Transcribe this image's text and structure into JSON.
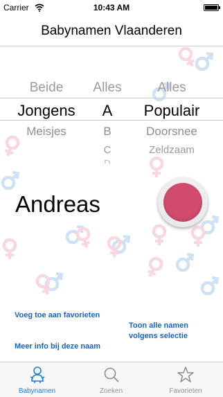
{
  "status_bar": {
    "carrier": "Carrier",
    "time": "10:43 AM"
  },
  "navbar": {
    "title": "Babynamen Vlaanderen"
  },
  "picker": {
    "gender": {
      "above": "Beide",
      "selected": "Jongens",
      "below": [
        "Meisjes"
      ]
    },
    "letter": {
      "above": "Alles",
      "selected": "A",
      "below": [
        "B",
        "C",
        "D"
      ]
    },
    "popularity": {
      "above": "Alles",
      "selected": "Populair",
      "below": [
        "Doorsnee",
        "Zeldzaam"
      ]
    }
  },
  "result": {
    "name": "Andreas"
  },
  "links": {
    "add_favorite": "Voeg toe aan favorieten",
    "more_info": "Meer info bij deze naam",
    "show_all_line1": "Toon alle namen",
    "show_all_line2": "volgens selectie"
  },
  "tabs": [
    {
      "label": "Babynamen",
      "icon": "baby-icon",
      "active": true
    },
    {
      "label": "Zoeken",
      "icon": "search-icon",
      "active": false
    },
    {
      "label": "Favorieten",
      "icon": "star-icon",
      "active": false
    }
  ],
  "colors": {
    "accent": "#1a7fd8",
    "button": "#d14b6c",
    "male_symbol": "#a8c8ec",
    "female_symbol": "#f2b6c6"
  }
}
